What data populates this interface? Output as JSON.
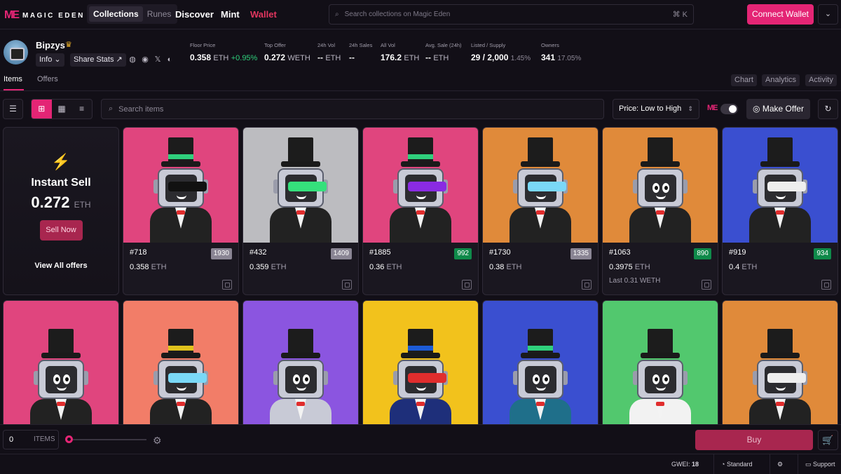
{
  "brand": {
    "mark": "ME",
    "name": "MAGIC EDEN"
  },
  "nav": {
    "collections": "Collections",
    "runes": "Runes",
    "discover": "Discover",
    "mint": "Mint",
    "wallet": "Wallet"
  },
  "search": {
    "placeholder": "Search collections on Magic Eden",
    "shortcut": "⌘ K"
  },
  "connect": "Connect Wallet",
  "collection": {
    "name": "Bipzys",
    "info": "Info",
    "share": "Share Stats",
    "stats": [
      {
        "label": "Floor Price",
        "value": "0.358",
        "unit": "ETH",
        "extra": "+0.95%"
      },
      {
        "label": "Top Offer",
        "value": "0.272",
        "unit": "WETH"
      },
      {
        "label": "24h Vol",
        "value": "--",
        "unit": "ETH"
      },
      {
        "label": "24h Sales",
        "value": "--"
      },
      {
        "label": "All Vol",
        "value": "176.2",
        "unit": "ETH"
      },
      {
        "label": "Avg. Sale (24h)",
        "value": "--",
        "unit": "ETH"
      },
      {
        "label": "Listed / Supply",
        "value": "29 / 2,000",
        "extra": "1.45%"
      },
      {
        "label": "Owners",
        "value": "341",
        "extra": "17.05%"
      }
    ]
  },
  "tabs": {
    "items": "Items",
    "offers": "Offers",
    "chart": "Chart",
    "analytics": "Analytics",
    "activity": "Activity"
  },
  "toolbar": {
    "search_placeholder": "Search items",
    "sort": "Price: Low to High",
    "toggle_mark": "ME",
    "make_offer": "Make Offer"
  },
  "instant": {
    "title": "Instant Sell",
    "amount": "0.272",
    "unit": "ETH",
    "sell": "Sell Now",
    "view_all": "View All offers"
  },
  "cards": [
    {
      "name": "#718",
      "rank": "1930",
      "price": "0.358",
      "unit": "ETH",
      "bg": "#e0457e",
      "last": ""
    },
    {
      "name": "#432",
      "rank": "1409",
      "price": "0.359",
      "unit": "ETH",
      "bg": "#bcbcc0",
      "last": ""
    },
    {
      "name": "#1885",
      "rank": "992",
      "price": "0.36",
      "unit": "ETH",
      "bg": "#e0457e",
      "last": ""
    },
    {
      "name": "#1730",
      "rank": "1335",
      "price": "0.38",
      "unit": "ETH",
      "bg": "#e08a3a",
      "last": ""
    },
    {
      "name": "#1063",
      "rank": "890",
      "price": "0.3975",
      "unit": "ETH",
      "bg": "#e08a3a",
      "last": "Last 0.31 WETH"
    },
    {
      "name": "#919",
      "rank": "934",
      "price": "0.4",
      "unit": "ETH",
      "bg": "#3a4fd0",
      "last": ""
    }
  ],
  "row2": [
    {
      "bg": "#e0457e"
    },
    {
      "bg": "#f27d68"
    },
    {
      "bg": "#8b55e0"
    },
    {
      "bg": "#f2c21c"
    },
    {
      "bg": "#3a4fd0"
    },
    {
      "bg": "#52c86e"
    },
    {
      "bg": "#e08a3a"
    }
  ],
  "bottom": {
    "qty": "0",
    "qty_label": "ITEMS",
    "buy": "Buy"
  },
  "status": {
    "gwei_label": "GWEI:",
    "gwei": "18",
    "mode": "Standard",
    "support": "Support"
  },
  "colors": {
    "accent": "#e42575",
    "positive": "#2fd07c"
  }
}
